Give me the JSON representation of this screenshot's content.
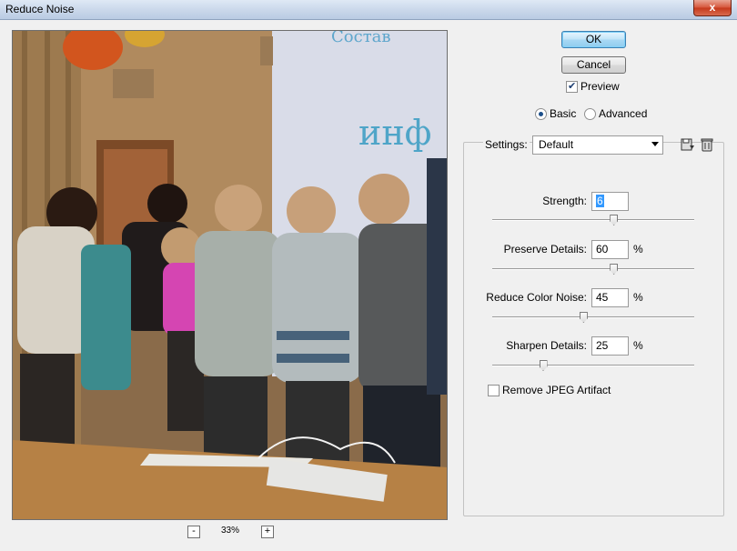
{
  "window": {
    "title": "Reduce Noise",
    "close_label": "x"
  },
  "preview": {
    "zoom_out_label": "-",
    "zoom_in_label": "+",
    "zoom_level": "33%",
    "photo_text": "инф",
    "photo_text_small": "Состав"
  },
  "buttons": {
    "ok_label": "OK",
    "cancel_label": "Cancel"
  },
  "preview_option": {
    "label": "Preview",
    "checked": true
  },
  "mode": {
    "basic_label": "Basic",
    "advanced_label": "Advanced",
    "selected": "Basic"
  },
  "settings": {
    "label": "Settings:",
    "value": "Default",
    "save_icon": "save-settings-icon",
    "delete_icon": "trash-icon"
  },
  "params": [
    {
      "label": "Strength:",
      "value": "6",
      "unit": "",
      "slider_fraction": 0.6
    },
    {
      "label": "Preserve Details:",
      "value": "60",
      "unit": "%",
      "slider_fraction": 0.6
    },
    {
      "label": "Reduce Color Noise:",
      "value": "45",
      "unit": "%",
      "slider_fraction": 0.45
    },
    {
      "label": "Sharpen Details:",
      "value": "25",
      "unit": "%",
      "slider_fraction": 0.25
    }
  ],
  "jpeg_option": {
    "label": "Remove JPEG Artifact",
    "checked": false
  }
}
